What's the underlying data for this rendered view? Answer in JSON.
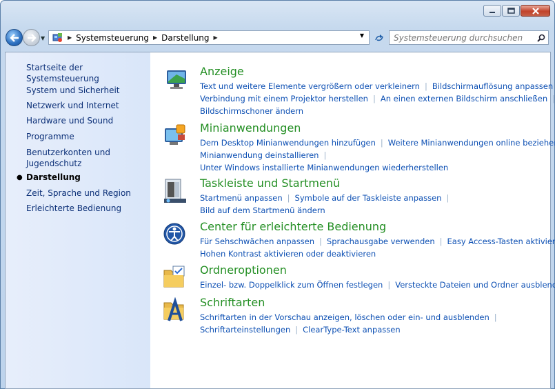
{
  "window": {
    "buttons": {
      "minimize": "minimize",
      "maximize": "maximize",
      "close": "close"
    }
  },
  "address": {
    "crumbs": [
      "Systemsteuerung",
      "Darstellung"
    ],
    "search_placeholder": "Systemsteuerung durchsuchen"
  },
  "sidebar": {
    "items": [
      {
        "label": "Startseite der Systemsteuerung"
      },
      {
        "label": "System und Sicherheit"
      },
      {
        "label": "Netzwerk und Internet"
      },
      {
        "label": "Hardware und Sound"
      },
      {
        "label": "Programme"
      },
      {
        "label": "Benutzerkonten und Jugendschutz"
      },
      {
        "label": "Darstellung",
        "active": true
      },
      {
        "label": "Zeit, Sprache und Region"
      },
      {
        "label": "Erleichterte Bedienung"
      }
    ]
  },
  "categories": [
    {
      "title": "Anzeige",
      "icon": "display-icon",
      "links": [
        [
          "Text und weitere Elemente vergrößern oder verkleinern",
          "Bildschirmauflösung anpassen"
        ],
        [
          "Verbindung mit einem Projektor herstellen",
          "An einen externen Bildschirm anschließen"
        ],
        [
          "Bildschirmschoner ändern"
        ]
      ]
    },
    {
      "title": "Minianwendungen",
      "icon": "gadgets-icon",
      "links": [
        [
          "Dem Desktop Minianwendungen hinzufügen",
          "Weitere Minianwendungen online beziehen"
        ],
        [
          "Minianwendung deinstallieren"
        ],
        [
          "Unter Windows installierte Minianwendungen wiederherstellen"
        ]
      ]
    },
    {
      "title": "Taskleiste und Startmenü",
      "icon": "taskbar-icon",
      "links": [
        [
          "Startmenü anpassen",
          "Symbole auf der Taskleiste anpassen"
        ],
        [
          "Bild auf dem Startmenü ändern"
        ]
      ]
    },
    {
      "title": "Center für erleichterte Bedienung",
      "icon": "ease-of-access-icon",
      "links": [
        [
          "Für Sehschwächen anpassen",
          "Sprachausgabe verwenden",
          "Easy Access-Tasten aktivieren"
        ],
        [
          "Hohen Kontrast aktivieren oder deaktivieren"
        ]
      ]
    },
    {
      "title": "Ordneroptionen",
      "icon": "folder-options-icon",
      "links": [
        [
          "Einzel- bzw. Doppelklick zum Öffnen festlegen",
          "Versteckte Dateien und Ordner ausblenden"
        ]
      ]
    },
    {
      "title": "Schriftarten",
      "icon": "fonts-icon",
      "links": [
        [
          "Schriftarten in der Vorschau anzeigen, löschen oder ein- und ausblenden"
        ],
        [
          "Schriftarteinstellungen",
          "ClearType-Text anpassen"
        ]
      ]
    }
  ]
}
